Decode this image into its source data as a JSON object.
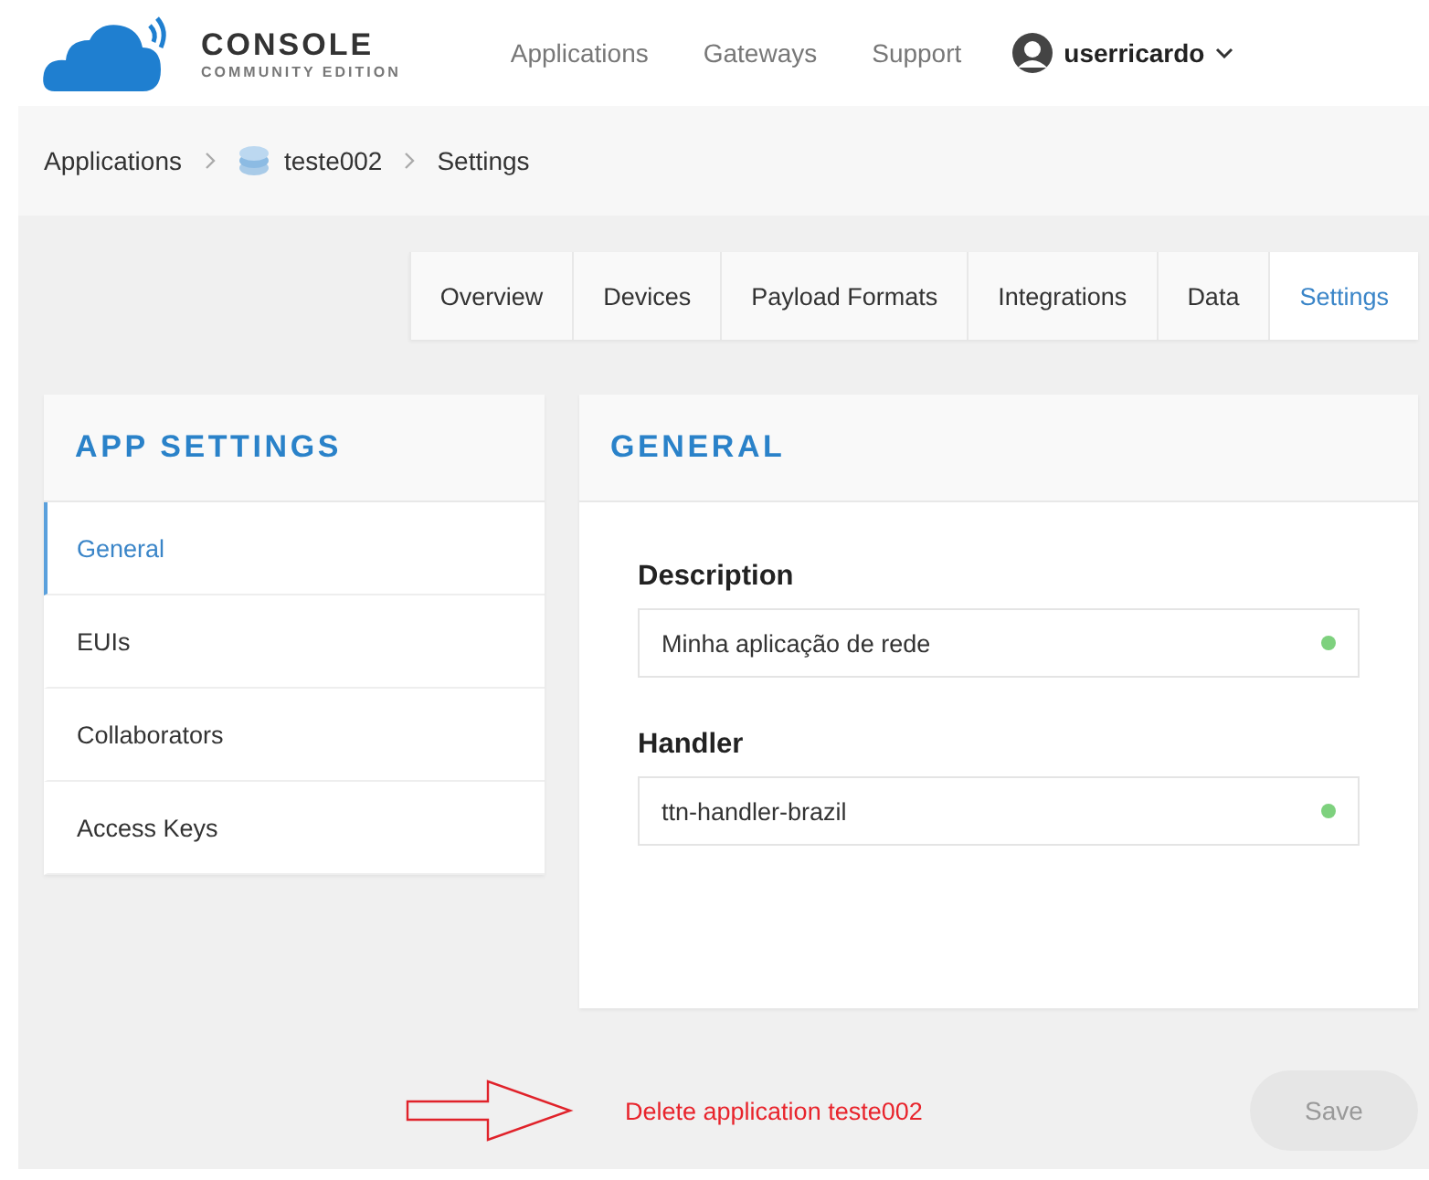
{
  "header": {
    "logo_title": "CONSOLE",
    "logo_subtitle": "COMMUNITY EDITION",
    "nav": [
      {
        "label": "Applications"
      },
      {
        "label": "Gateways"
      },
      {
        "label": "Support"
      }
    ],
    "user": "userricardo"
  },
  "breadcrumb": [
    {
      "label": "Applications",
      "kind": "link"
    },
    {
      "label": "teste002",
      "kind": "app"
    },
    {
      "label": "Settings",
      "kind": "current"
    }
  ],
  "tabs": [
    {
      "label": "Overview",
      "selected": false
    },
    {
      "label": "Devices",
      "selected": false
    },
    {
      "label": "Payload Formats",
      "selected": false
    },
    {
      "label": "Integrations",
      "selected": false
    },
    {
      "label": "Data",
      "selected": false
    },
    {
      "label": "Settings",
      "selected": true
    }
  ],
  "sidebar": {
    "title": "APP SETTINGS",
    "items": [
      {
        "label": "General",
        "selected": true
      },
      {
        "label": "EUIs",
        "selected": false
      },
      {
        "label": "Collaborators",
        "selected": false
      },
      {
        "label": "Access Keys",
        "selected": false
      }
    ]
  },
  "panel": {
    "title": "GENERAL",
    "fields": [
      {
        "label": "Description",
        "value": "Minha aplicação de rede",
        "valid": true
      },
      {
        "label": "Handler",
        "value": "ttn-handler-brazil",
        "valid": true
      }
    ]
  },
  "footer": {
    "delete_link": "Delete application teste002",
    "save": {
      "label": "Save",
      "disabled": true
    }
  }
}
